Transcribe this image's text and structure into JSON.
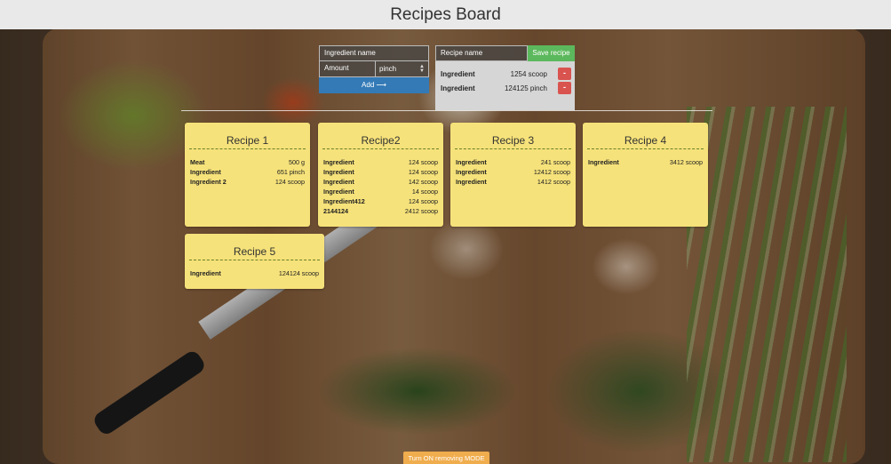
{
  "header": {
    "title": "Recipes Board"
  },
  "ingredient_form": {
    "name_placeholder": "Ingredient name",
    "amount_placeholder": "Amount",
    "unit_selected": "pinch",
    "add_label": "Add ⟶"
  },
  "recipe_form": {
    "name_placeholder": "Recipe name",
    "save_label": "Save recipe",
    "pending": [
      {
        "name": "Ingredient",
        "amount": "1254 scoop",
        "remove": "-"
      },
      {
        "name": "Ingredient",
        "amount": "124125 pinch",
        "remove": "-"
      }
    ]
  },
  "recipes": [
    {
      "title": "Recipe 1",
      "items": [
        {
          "name": "Meat",
          "amount": "500 g"
        },
        {
          "name": "Ingredient",
          "amount": "651 pinch"
        },
        {
          "name": "Ingredient 2",
          "amount": "124 scoop"
        }
      ]
    },
    {
      "title": "Recipe2",
      "items": [
        {
          "name": "Ingredient",
          "amount": "124 scoop"
        },
        {
          "name": "Ingredient",
          "amount": "124 scoop"
        },
        {
          "name": "Ingredient",
          "amount": "142 scoop"
        },
        {
          "name": "Ingredient",
          "amount": "14 scoop"
        },
        {
          "name": "Ingredient412",
          "amount": "124 scoop"
        },
        {
          "name": "2144124",
          "amount": "2412 scoop"
        }
      ]
    },
    {
      "title": "Recipe 3",
      "items": [
        {
          "name": "Ingredient",
          "amount": "241 scoop"
        },
        {
          "name": "Ingredient",
          "amount": "12412 scoop"
        },
        {
          "name": "Ingredient",
          "amount": "1412 scoop"
        }
      ]
    },
    {
      "title": "Recipe 4",
      "items": [
        {
          "name": "Ingredient",
          "amount": "3412 scoop"
        }
      ]
    },
    {
      "title": "Recipe 5",
      "items": [
        {
          "name": "Ingredient",
          "amount": "124124 scoop"
        }
      ]
    }
  ],
  "footer": {
    "remove_mode_label": "Turn ON removing MODE"
  },
  "colors": {
    "card": "#f6e27a",
    "add_button": "#337ab7",
    "save_button": "#5cb85c",
    "remove_button": "#d9534f",
    "remove_mode_button": "#f0ad4e"
  }
}
